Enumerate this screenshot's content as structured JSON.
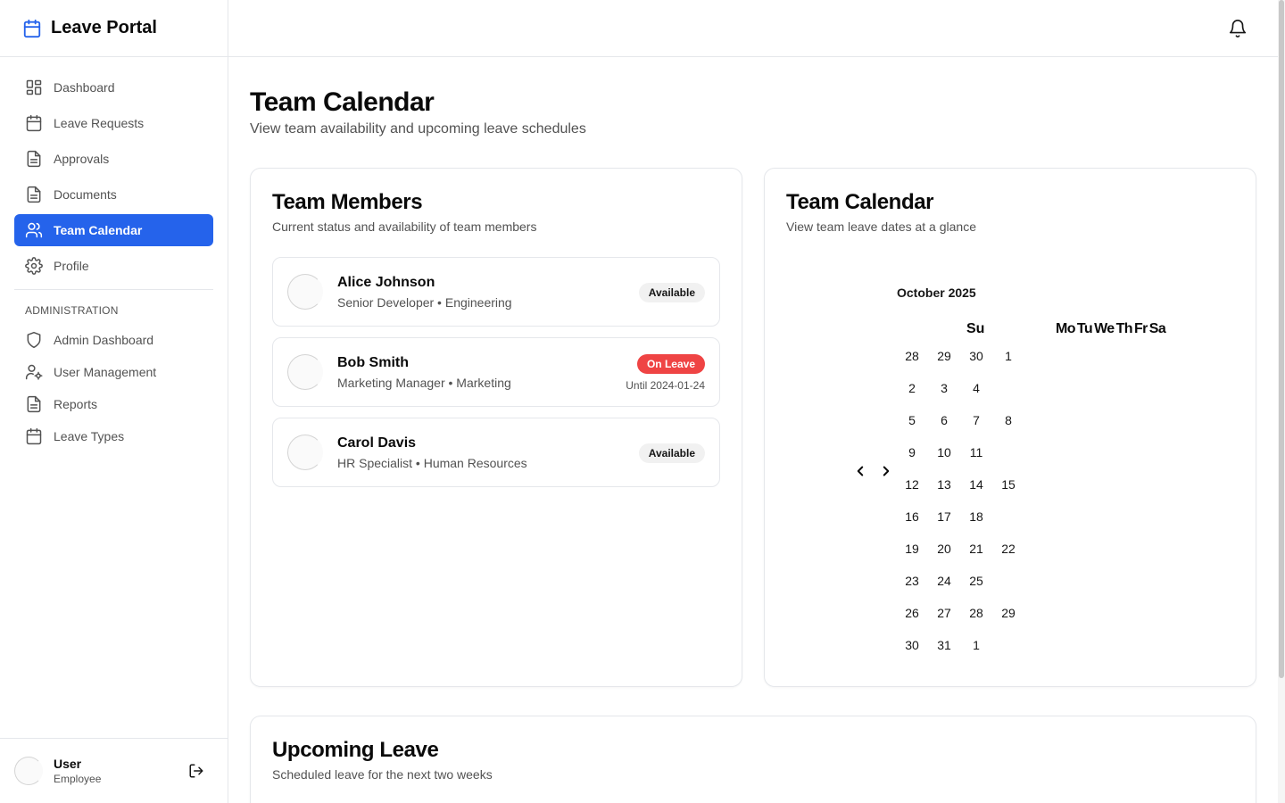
{
  "brand": {
    "name": "Leave Portal"
  },
  "nav": {
    "items": [
      {
        "label": "Dashboard"
      },
      {
        "label": "Leave Requests"
      },
      {
        "label": "Approvals"
      },
      {
        "label": "Documents"
      },
      {
        "label": "Team Calendar"
      },
      {
        "label": "Profile"
      }
    ],
    "admin_section": "ADMINISTRATION",
    "admin_items": [
      {
        "label": "Admin Dashboard"
      },
      {
        "label": "User Management"
      },
      {
        "label": "Reports"
      },
      {
        "label": "Leave Types"
      }
    ]
  },
  "user": {
    "name": "User",
    "role": "Employee"
  },
  "page": {
    "title": "Team Calendar",
    "subtitle": "View team availability and upcoming leave schedules"
  },
  "members_card": {
    "title": "Team Members",
    "description": "Current status and availability of team members",
    "members": [
      {
        "name": "Alice Johnson",
        "role": "Senior Developer • Engineering",
        "status": "Available"
      },
      {
        "name": "Bob Smith",
        "role": "Marketing Manager • Marketing",
        "status": "On Leave",
        "until": "Until 2024-01-24"
      },
      {
        "name": "Carol Davis",
        "role": "HR Specialist • Human Resources",
        "status": "Available"
      }
    ]
  },
  "calendar_card": {
    "title": "Team Calendar",
    "description": "View team leave dates at a glance",
    "month": "October 2025",
    "weekday_first": "Su",
    "weekdays_rest": [
      "Mo",
      "Tu",
      "We",
      "Th",
      "Fr",
      "Sa"
    ],
    "weeks": [
      [
        "28",
        "29",
        "30",
        "1"
      ],
      [
        "2",
        "3",
        "4"
      ],
      [
        "5",
        "6",
        "7",
        "8"
      ],
      [
        "9",
        "10",
        "11"
      ],
      [
        "12",
        "13",
        "14",
        "15"
      ],
      [
        "16",
        "17",
        "18"
      ],
      [
        "19",
        "20",
        "21",
        "22"
      ],
      [
        "23",
        "24",
        "25"
      ],
      [
        "26",
        "27",
        "28",
        "29"
      ],
      [
        "30",
        "31",
        "1"
      ]
    ]
  },
  "upcoming_card": {
    "title": "Upcoming Leave",
    "description": "Scheduled leave for the next two weeks"
  },
  "colors": {
    "accent": "#2563eb",
    "danger": "#ef4444",
    "muted": "#525252",
    "border": "#e5e7eb"
  }
}
